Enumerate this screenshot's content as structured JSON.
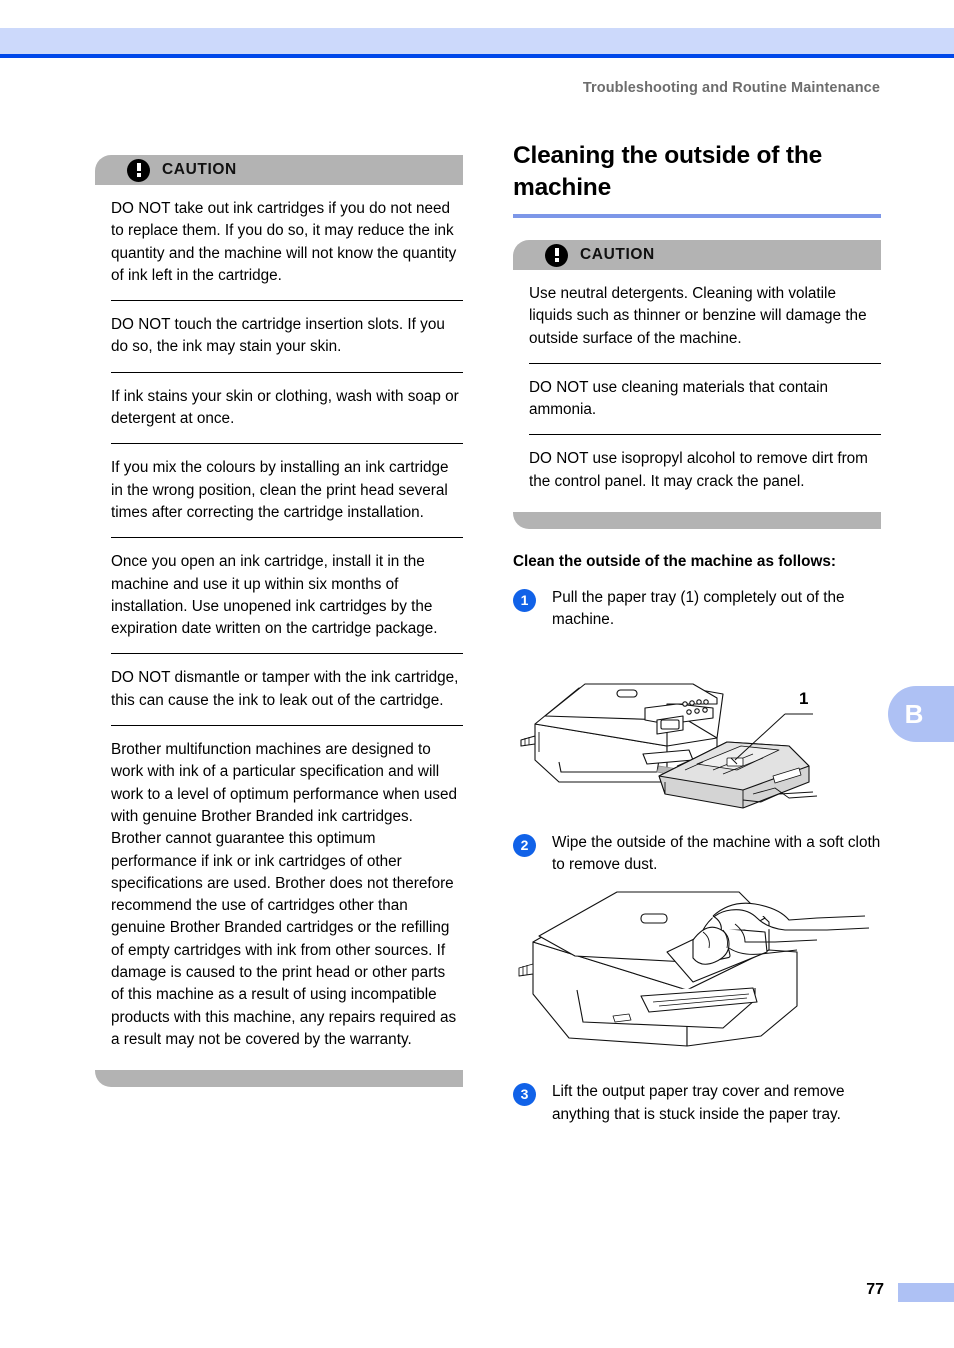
{
  "page": {
    "running_head": "Troubleshooting and Routine Maintenance",
    "page_number": "77",
    "edge_tab_label": "B",
    "accent_blue": "#0048ea",
    "band_blue": "#ccd9fb",
    "heading_rule_blue": "#7d97e8",
    "step_circle_blue": "#1162e8",
    "caution_gray": "#b3b3b3"
  },
  "left_column": {
    "caution": {
      "title": "CAUTION",
      "icon": "exclamation-circle-icon",
      "items": [
        "DO NOT take out ink cartridges if you do not need to replace them. If you do so, it may reduce the ink quantity and the machine will not know the quantity of ink left in the cartridge.",
        "DO NOT touch the cartridge insertion slots. If you do so, the ink may stain your skin.",
        "If ink stains your skin or clothing, wash with soap or detergent at once.",
        "If you mix the colours by installing an ink cartridge in the wrong position, clean the print head several times after correcting the cartridge installation.",
        "Once you open an ink cartridge, install it in the machine and use it up within six months of installation. Use unopened ink cartridges by the expiration date written on the cartridge package.",
        "DO NOT dismantle or tamper with the ink cartridge, this can cause the ink to leak out of the cartridge.",
        "Brother multifunction machines are designed to work with ink of a particular specification and will work to a level of optimum performance when used with genuine Brother Branded ink cartridges. Brother cannot guarantee this optimum performance if ink or ink cartridges of other specifications are used. Brother does not therefore recommend the use of cartridges other than genuine Brother Branded cartridges or the refilling of empty cartridges with ink from other sources. If damage is caused to the print head or other parts of this machine as a result of using incompatible products with this machine, any repairs required as a result may not be covered by the warranty."
      ]
    }
  },
  "right_column": {
    "section_title": "Cleaning the outside of the machine",
    "caution": {
      "title": "CAUTION",
      "icon": "exclamation-circle-icon",
      "items": [
        "Use neutral detergents. Cleaning with volatile liquids such as thinner or benzine will damage the outside surface of the machine.",
        "DO NOT use cleaning materials that contain ammonia.",
        "DO NOT use isopropyl alcohol to remove dirt from the control panel. It may crack the panel."
      ]
    },
    "procedure_lead": "Clean the outside of the machine as follows:",
    "steps": [
      {
        "number": "1",
        "text": "Pull the paper tray (1) completely out of the machine.",
        "figure": "printer-paper-tray-removal-diagram",
        "callout": "1"
      },
      {
        "number": "2",
        "text": "Wipe the outside of the machine with a soft cloth to remove dust.",
        "figure": "printer-wipe-with-cloth-diagram"
      },
      {
        "number": "3",
        "text": "Lift the output paper tray cover and remove anything that is stuck inside the paper tray."
      }
    ]
  }
}
